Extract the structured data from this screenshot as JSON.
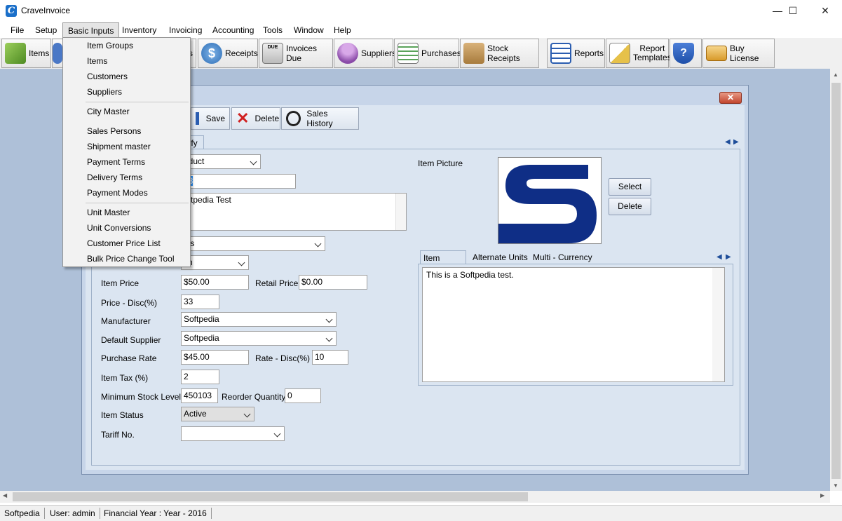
{
  "window": {
    "title": "CraveInvoice",
    "app_icon_letter": "C",
    "minimize": "—",
    "maximize": "☐",
    "close": "✕"
  },
  "menu": [
    "File",
    "Setup",
    "Basic Inputs",
    "Inventory",
    "Invoicing",
    "Accounting",
    "Tools",
    "Window",
    "Help"
  ],
  "toolbar": [
    {
      "label": "Items",
      "icon": "items-icon"
    },
    {
      "label": "",
      "icon": "customers-icon"
    },
    {
      "label": "s",
      "icon": "partial-hidden-icon"
    },
    {
      "label": "Receipts",
      "icon": "dollar-icon"
    },
    {
      "label": "Invoices Due",
      "icon": "invoice-due-icon"
    },
    {
      "label": "Suppliers",
      "icon": "supplier-person-icon"
    },
    {
      "label": "Purchases",
      "icon": "purchases-document-icon"
    },
    {
      "label": "Stock Receipts",
      "icon": "stock-box-icon"
    },
    {
      "label": "Reports",
      "icon": "reports-list-icon"
    },
    {
      "label": "Report\nTemplates",
      "icon": "report-templates-icon"
    },
    {
      "label": "",
      "icon": "help-shield-icon"
    },
    {
      "label": "Buy License",
      "icon": "license-card-icon"
    }
  ],
  "dropdown": {
    "group1": [
      "Item Groups",
      "Items",
      "Customers",
      "Suppliers"
    ],
    "group2": [
      "City Master",
      "Sales Persons",
      "Shipment master",
      "Payment Terms",
      "Delivery Terms",
      "Payment Modes"
    ],
    "group3": [
      "Unit Master",
      "Unit Conversions",
      "Customer Price List",
      "Bulk Price Change Tool"
    ]
  },
  "child_toolbar": {
    "save": "Save",
    "delete": "Delete",
    "sales_history": "Sales History"
  },
  "tab_visible_fragment": "dify",
  "form": {
    "item_type": "oduct",
    "item_code": "08",
    "description": "oftpedia Test",
    "group": "sts",
    "unit": "ch",
    "item_price_label": "Item Price",
    "item_price": "$50.00",
    "retail_price_label": "Retail Price",
    "retail_price": "$0.00",
    "price_disc_label": "Price - Disc(%)",
    "price_disc": "33",
    "manufacturer_label": "Manufacturer",
    "manufacturer": "Softpedia",
    "default_supplier_label": "Default Supplier",
    "default_supplier": "Softpedia",
    "purchase_rate_label": "Purchase Rate",
    "purchase_rate": "$45.00",
    "rate_disc_label": "Rate - Disc(%)",
    "rate_disc": "10",
    "item_tax_label": "Item Tax (%)",
    "item_tax": "2",
    "min_stock_label": "Minimum Stock Level",
    "min_stock": "450103",
    "reorder_label": "Reorder Quantity",
    "reorder": "0",
    "item_status_label": "Item Status",
    "item_status": "Active",
    "tariff_label": "Tariff No.",
    "tariff": ""
  },
  "picture": {
    "label": "Item Picture",
    "select": "Select",
    "delete": "Delete"
  },
  "detail_tabs": [
    "Item Details",
    "Alternate Units",
    "Multi - Currency"
  ],
  "detail_text": "This is a Softpedia test.",
  "status": [
    "Softpedia",
    "User: admin",
    "Financial Year : Year - 2016"
  ]
}
